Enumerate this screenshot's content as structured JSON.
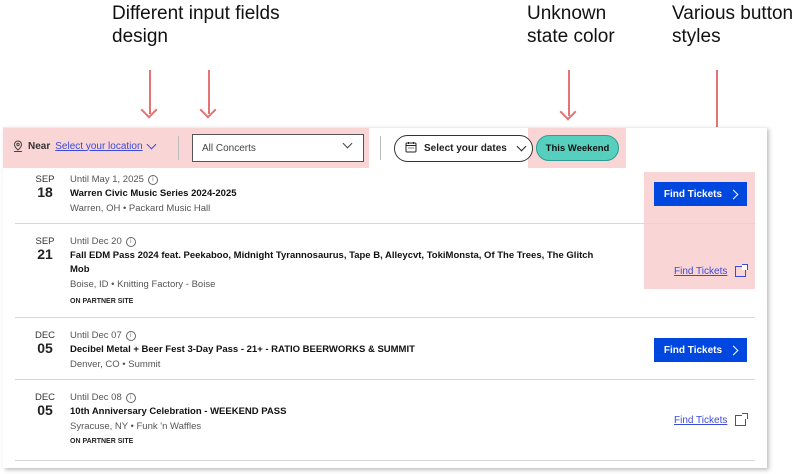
{
  "annotations": {
    "input_fields": "Different input fields design",
    "state_color": "Unknown state color",
    "button_styles": "Various button styles"
  },
  "filters": {
    "near_label": "Near",
    "location_link": "Select your location",
    "category_select": "All Concerts",
    "dates_button": "Select your dates",
    "weekend_chip": "This Weekend"
  },
  "events": [
    {
      "month": "SEP",
      "day": "18",
      "until": "Until May 1, 2025",
      "title": "Warren Civic Music Series 2024-2025",
      "venue": "Warren, OH • Packard Music Hall",
      "partner": "",
      "action": "Find Tickets",
      "action_type": "button"
    },
    {
      "month": "SEP",
      "day": "21",
      "until": "Until Dec 20",
      "title": "Fall EDM Pass 2024 feat. Peekaboo, Midnight Tyrannosaurus, Tape B, Alleycvt, TokiMonsta, Of The Trees, The Glitch Mob",
      "venue": "Boise, ID • Knitting Factory - Boise",
      "partner": "ON PARTNER SITE",
      "action": "Find Tickets",
      "action_type": "link"
    },
    {
      "month": "DEC",
      "day": "05",
      "until": "Until Dec 07",
      "title": "Decibel Metal + Beer Fest 3-Day Pass - 21+ - RATIO BEERWORKS & SUMMIT",
      "venue": "Denver, CO • Summit",
      "partner": "",
      "action": "Find Tickets",
      "action_type": "button"
    },
    {
      "month": "DEC",
      "day": "05",
      "until": "Until Dec 08",
      "title": "10th Anniversary Celebration - WEEKEND PASS",
      "venue": "Syracuse, NY • Funk 'n Waffles",
      "partner": "ON PARTNER SITE",
      "action": "Find Tickets",
      "action_type": "link"
    }
  ],
  "colors": {
    "highlight": "#f8bebe",
    "primary_button": "#0047e0",
    "weekend_chip": "#56cfbf",
    "link": "#3b4bd8"
  }
}
